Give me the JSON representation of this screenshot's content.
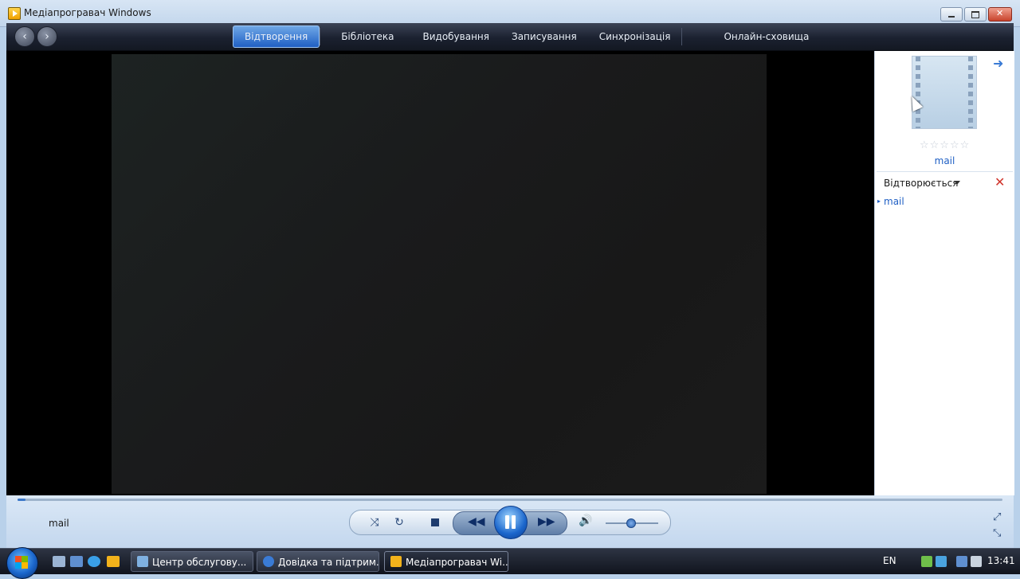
{
  "window": {
    "title": "Медіапрогравач Windows"
  },
  "nav": {
    "back_icon": "back-arrow-icon",
    "forward_icon": "forward-arrow-icon",
    "tabs": [
      {
        "label": "Відтворення",
        "active": true
      },
      {
        "label": "Бібліотека"
      },
      {
        "label": "Видобування"
      },
      {
        "label": "Записування"
      },
      {
        "label": "Синхронізація"
      },
      {
        "label": "Онлайн-сховища"
      }
    ]
  },
  "side": {
    "now_title": "mail",
    "rating": "☆☆☆☆☆",
    "playing_header": "Відтворюється",
    "playlist": [
      "mail"
    ],
    "accent": "#1f5fc4"
  },
  "controls": {
    "now_playing": "mail",
    "shuffle": "⤨",
    "repeat": "↻",
    "rewind": "◀◀",
    "forward": "▶▶",
    "volume": "🔊",
    "expand": "⤢",
    "shrink": "⤡"
  },
  "taskbar": {
    "tasks": [
      {
        "label": "Центр обслугову..."
      },
      {
        "label": "Довідка та підтрим..."
      },
      {
        "label": "Медіапрогравач Wi..."
      }
    ],
    "lang": "EN",
    "clock": "13:41"
  }
}
